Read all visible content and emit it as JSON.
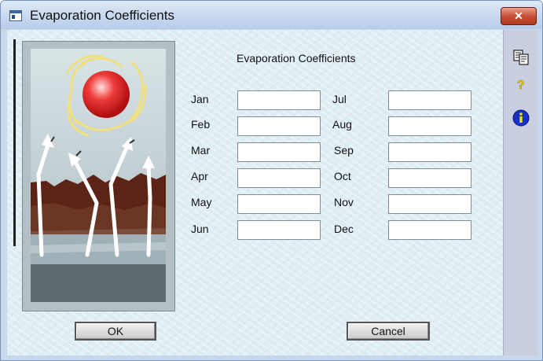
{
  "window": {
    "title": "Evaporation Coefficients"
  },
  "form": {
    "heading": "Evaporation Coefficients",
    "months_left": [
      {
        "label": "Jan",
        "value": ""
      },
      {
        "label": "Feb",
        "value": ""
      },
      {
        "label": "Mar",
        "value": ""
      },
      {
        "label": "Apr",
        "value": ""
      },
      {
        "label": "May",
        "value": ""
      },
      {
        "label": "Jun",
        "value": ""
      }
    ],
    "months_right": [
      {
        "label": "Jul",
        "value": ""
      },
      {
        "label": "Aug",
        "value": ""
      },
      {
        "label": "Sep",
        "value": ""
      },
      {
        "label": "Oct",
        "value": ""
      },
      {
        "label": "Nov",
        "value": ""
      },
      {
        "label": "Dec",
        "value": ""
      }
    ]
  },
  "buttons": {
    "ok": "OK",
    "cancel": "Cancel"
  },
  "toolbar": {
    "items": [
      {
        "icon": "copy-icon"
      },
      {
        "icon": "help-question-icon"
      },
      {
        "icon": "info-icon"
      }
    ]
  },
  "colors": {
    "titlebar": "#c6d7ee",
    "close": "#c74f34",
    "client": "#dfeef4",
    "sun": "#e02020"
  }
}
